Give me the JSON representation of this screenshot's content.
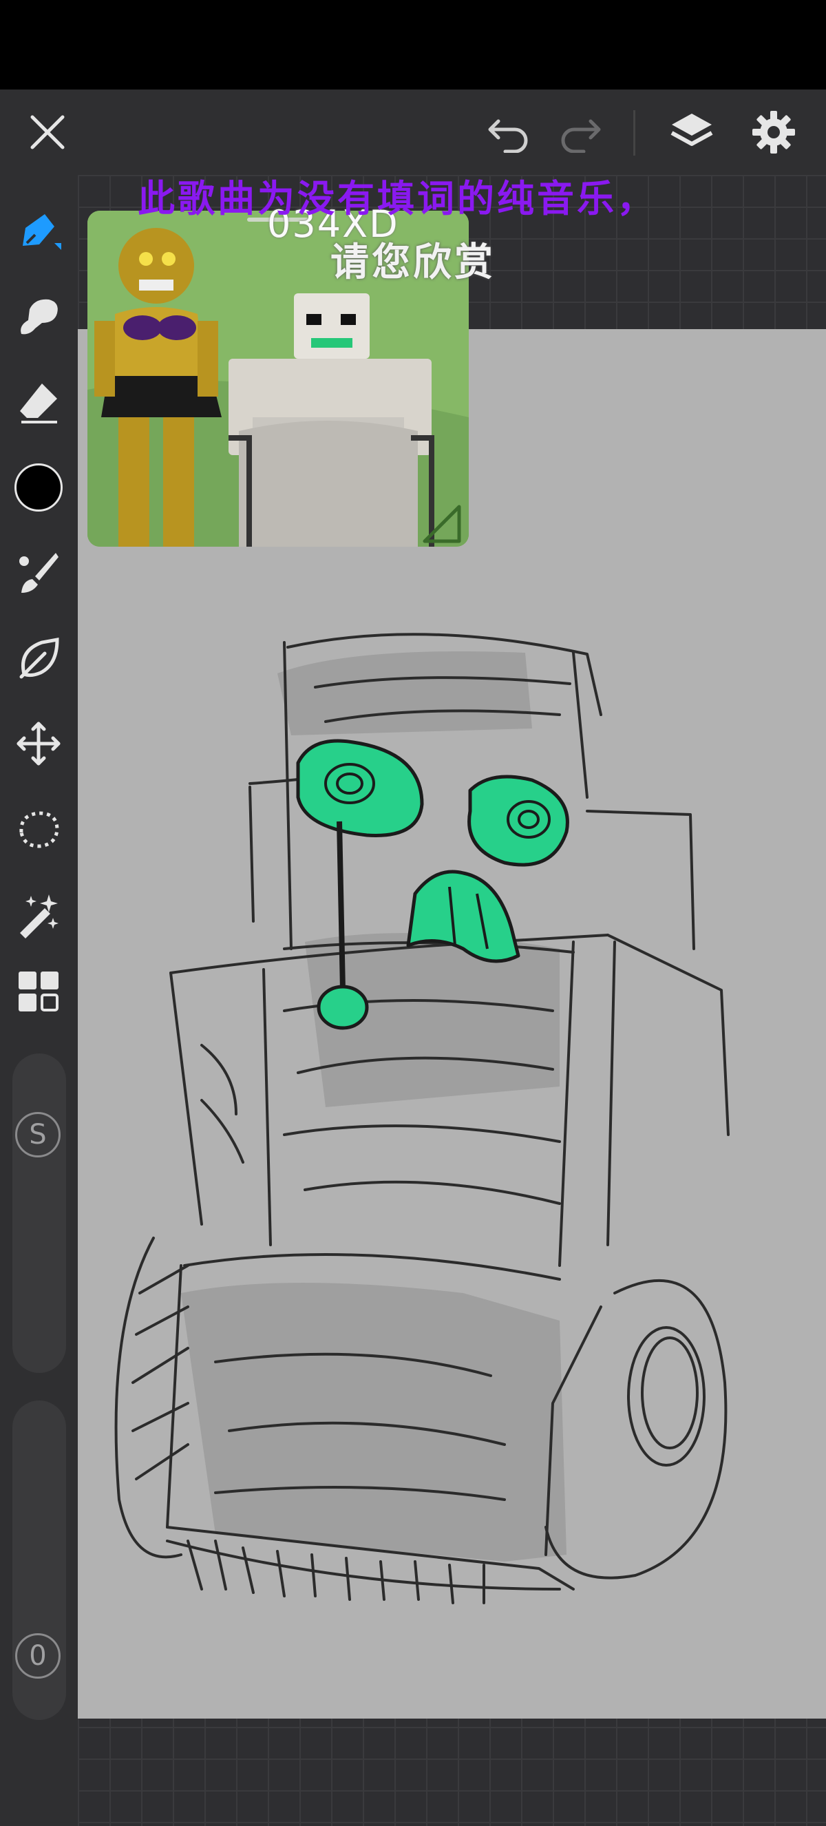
{
  "toolbar": {
    "close": "close-icon",
    "undo": "undo-icon",
    "redo": "redo-icon",
    "layers": "layers-icon",
    "settings": "gear-icon"
  },
  "tools": [
    "pen-icon",
    "smudge-icon",
    "eraser-icon",
    "color-swatch",
    "brush-icon",
    "leaf-icon",
    "move-icon",
    "lasso-icon",
    "magic-wand-icon",
    "grid-icon"
  ],
  "colors": {
    "active_tool": "#1e9bff",
    "current_color": "#000000",
    "canvas": "#b2b2b2",
    "accent_green": "#27d08a"
  },
  "size_slider": {
    "badge": "S"
  },
  "opacity_slider": {
    "badge": "0"
  },
  "video_overlay": {
    "subtitle_line1": "此歌曲为没有填词的纯音乐，",
    "subtitle_line2": "请您欣赏",
    "handle": "034XD"
  }
}
